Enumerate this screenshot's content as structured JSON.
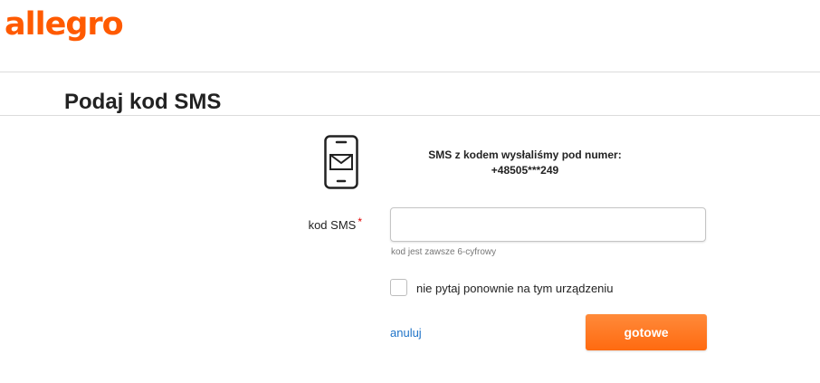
{
  "brand": {
    "logo_text": "allegro",
    "color": "#ff5a00"
  },
  "page": {
    "title": "Podaj kod SMS"
  },
  "sms_info": {
    "icon": "phone-message-icon",
    "line1": "SMS z kodem wysłaliśmy pod numer:",
    "phone_number": "+48505***249"
  },
  "form": {
    "code_label": "kod SMS",
    "required_mark": "*",
    "code_value": "",
    "code_placeholder": "",
    "hint": "kod jest zawsze 6-cyfrowy",
    "remember_label": "nie pytaj ponownie na tym urządzeniu",
    "remember_checked": false,
    "cancel_label": "anuluj",
    "submit_label": "gotowe",
    "link_color": "#1e73c8",
    "button_color": "#ff6a10"
  }
}
